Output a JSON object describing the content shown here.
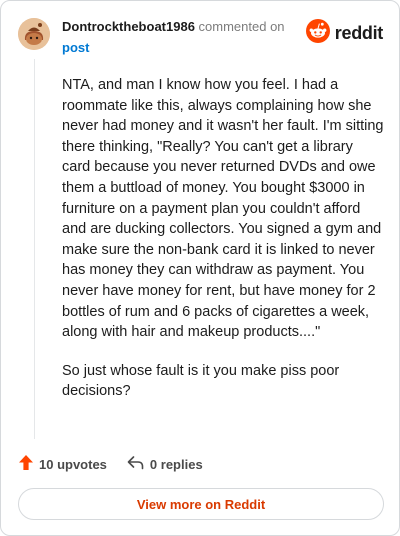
{
  "comment": {
    "username": "Dontrocktheboat1986",
    "action_text": "commented on",
    "post_link": "post",
    "paragraphs": [
      "NTA, and man I know how you feel. I had a roommate like this, always complaining how she never had money and it wasn't her fault. I'm sitting there thinking, \"Really? You can't get a library card because you never returned DVDs and owe them a buttload of money. You bought $3000 in furniture on a payment plan you couldn't afford and are ducking collectors. You signed a gym and make sure the non-bank card it is linked to never has money they can withdraw as payment. You never have money for rent, but have money for 2 bottles of rum and 6 packs of cigarettes a week, along with hair and makeup products....\"",
      "So just whose fault is it you make piss poor decisions?"
    ]
  },
  "brand": {
    "name": "reddit",
    "color": "#ff4500"
  },
  "actions": {
    "upvotes": "10 upvotes",
    "replies": "0 replies",
    "upvote_color": "#ff4500"
  },
  "footer": {
    "view_more": "View more on Reddit",
    "link_color": "#d93a00"
  },
  "icons": {
    "avatar": "snoo-avatar-icon",
    "logo": "reddit-logo-icon",
    "upvote": "upvote-arrow-icon",
    "reply": "reply-arrow-icon"
  }
}
